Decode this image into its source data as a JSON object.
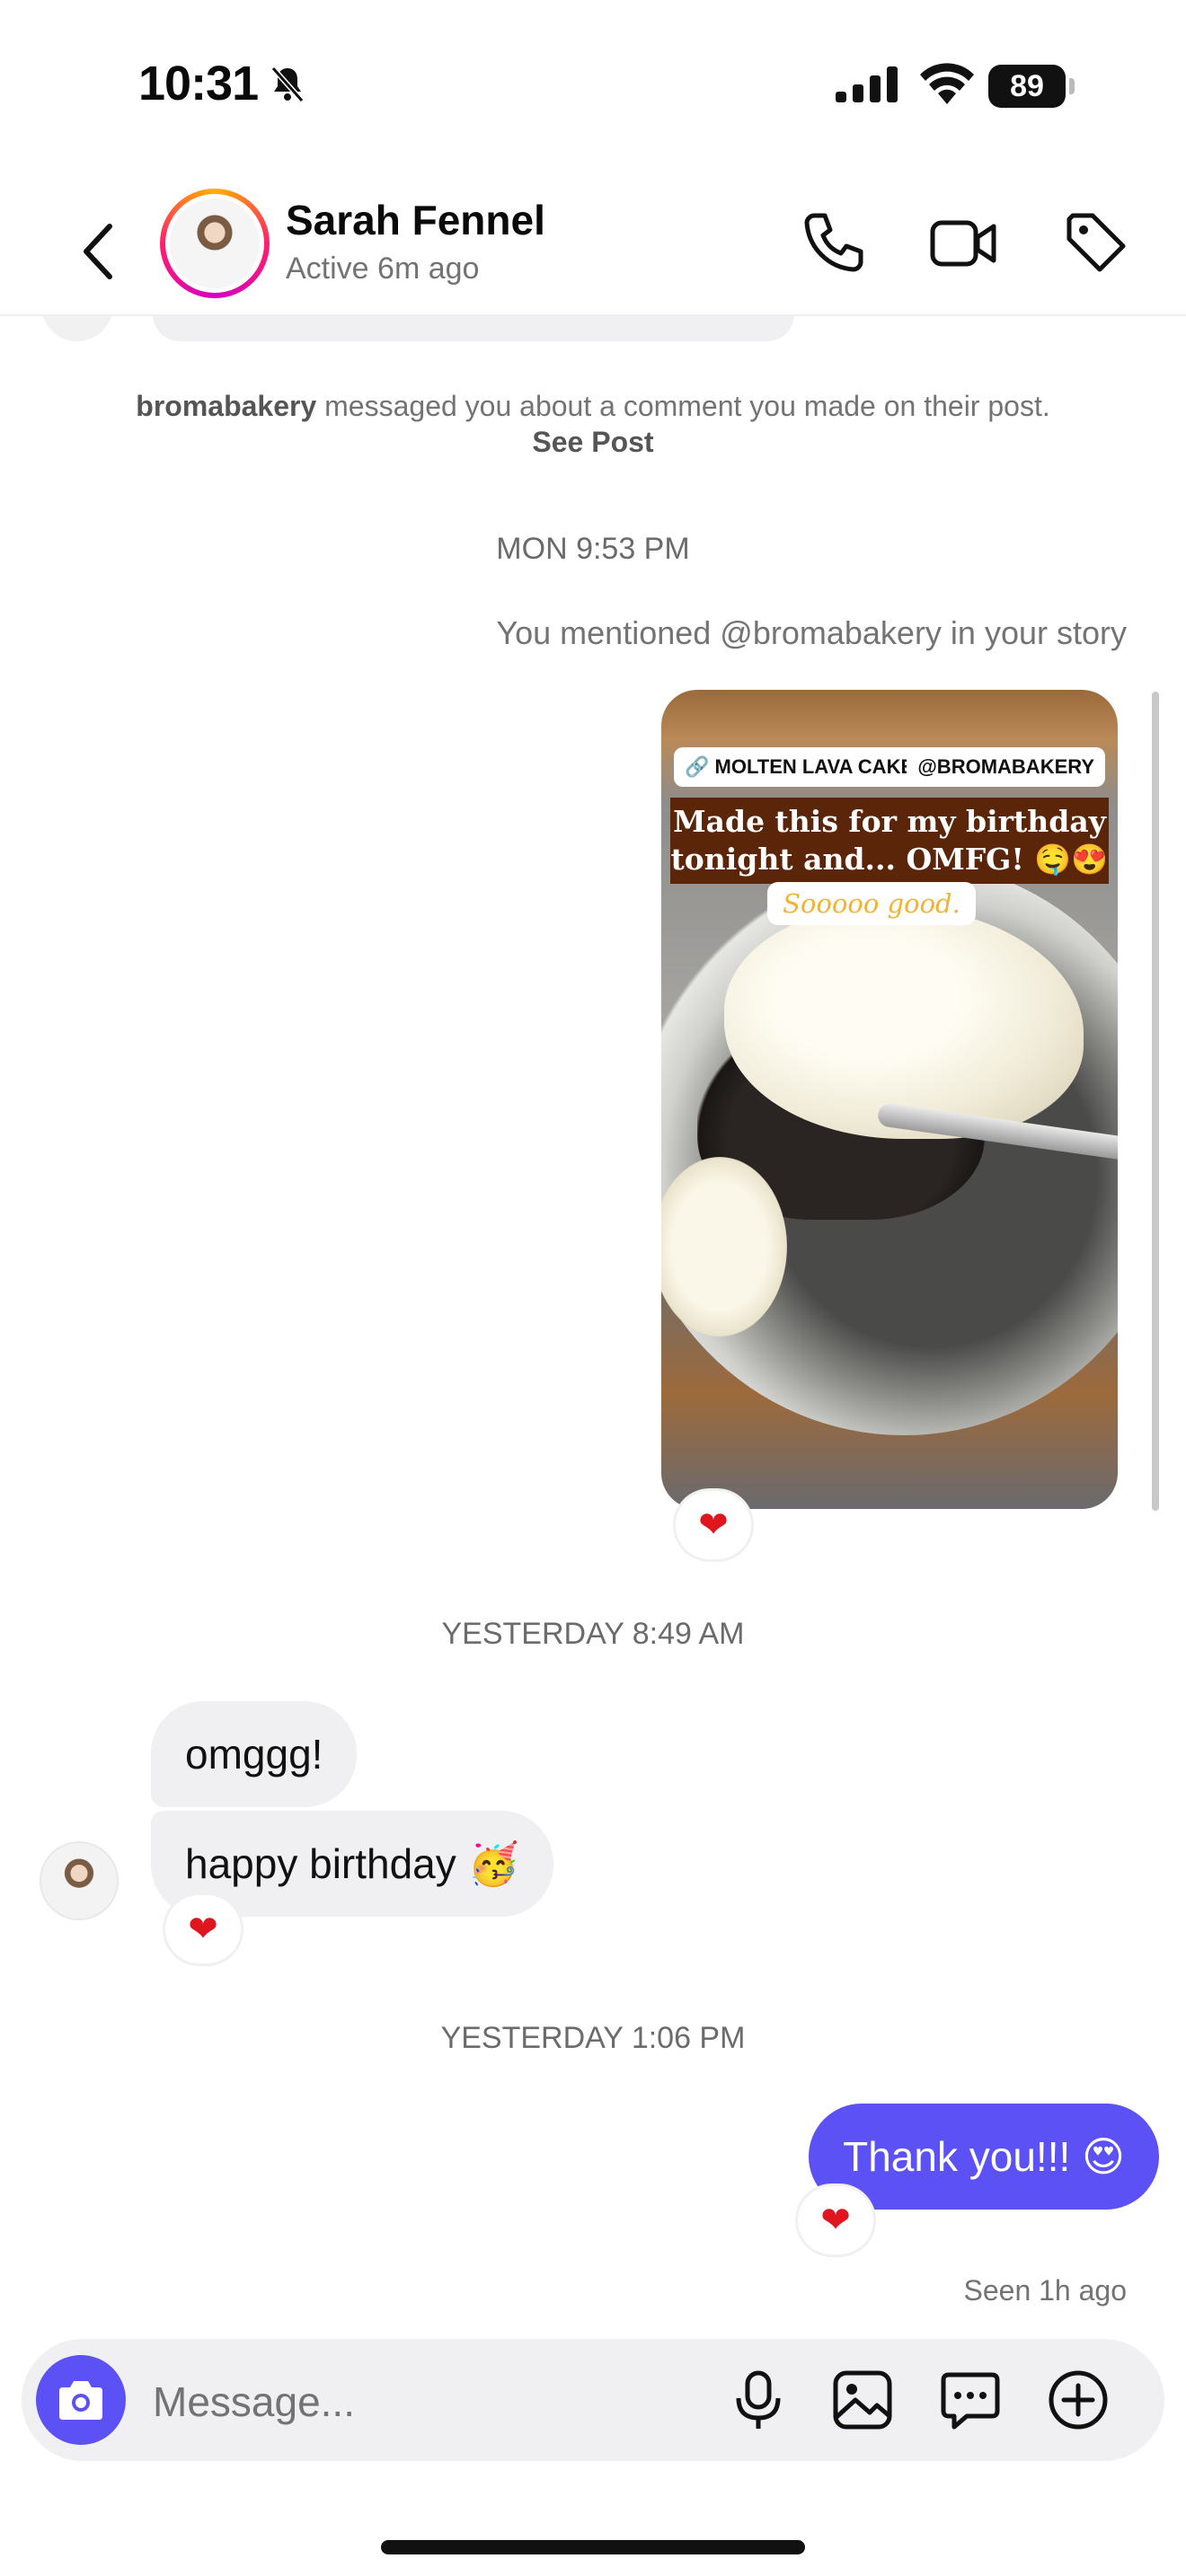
{
  "status_bar": {
    "time": "10:31",
    "battery": "89"
  },
  "header": {
    "name": "Sarah Fennel",
    "status": "Active 6m ago"
  },
  "system_message": {
    "sender": "bromabakery",
    "text": " messaged you about a comment you made on their post. ",
    "link": "See Post"
  },
  "timestamps": {
    "mon": "MON 9:53 PM",
    "yesterday_1": "YESTERDAY 8:49 AM",
    "yesterday_2": "YESTERDAY 1:06 PM"
  },
  "story": {
    "note": "You mentioned @bromabakery in your story",
    "link_tag": "MOLTEN LAVA CAKE",
    "mention_tag": "@BROMABAKERY",
    "caption": "Made this for my birthday tonight and... OMFG! 🤤😍",
    "subtitle": "Sooooo good."
  },
  "messages": {
    "incoming_1": "omggg!",
    "incoming_2": "happy birthday 🥳",
    "outgoing_1": "Thank you!!! 😍",
    "seen": "Seen 1h ago"
  },
  "reactions": {
    "story": "❤",
    "incoming": "❤",
    "outgoing": "❤"
  },
  "composer": {
    "placeholder": "Message..."
  },
  "colors": {
    "accent": "#5b51f5",
    "bubble_in": "#f0f0f2",
    "reaction": "#e0161e"
  }
}
